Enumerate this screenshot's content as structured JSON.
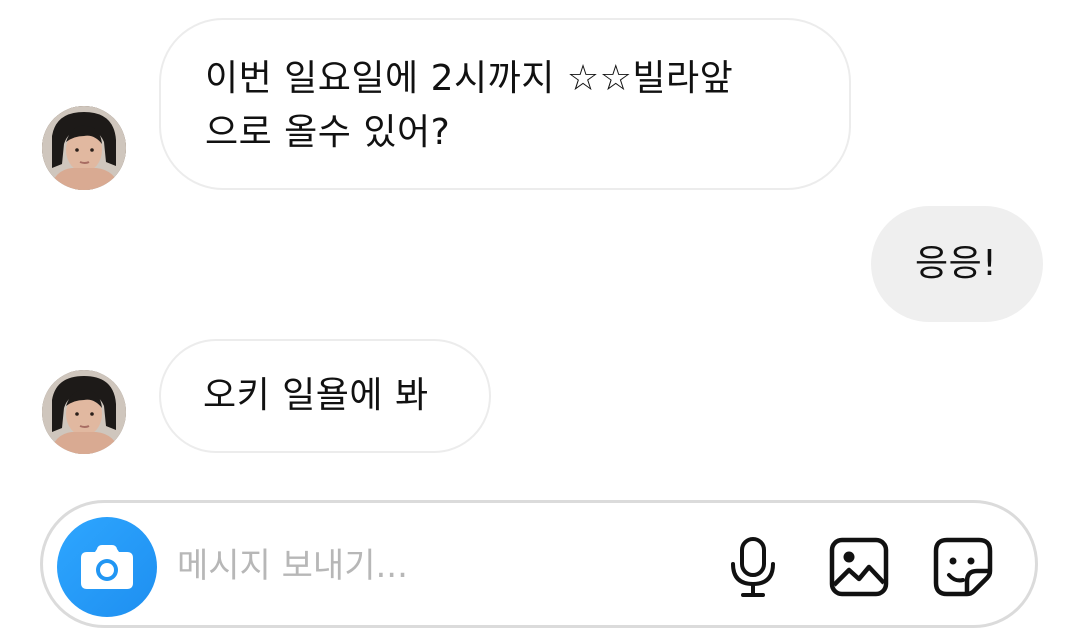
{
  "conversation": {
    "messages": [
      {
        "direction": "received",
        "lines": [
          "이번 일요일에 2시까지 ☆☆빌라앞",
          "으로 올수 있어?"
        ]
      },
      {
        "direction": "sent",
        "text": "응응!"
      },
      {
        "direction": "received",
        "text": "오키 일욜에 봐"
      }
    ]
  },
  "composer": {
    "placeholder": "메시지 보내기...",
    "camera_icon": "camera-icon",
    "mic_icon": "microphone-icon",
    "gallery_icon": "image-icon",
    "sticker_icon": "sticker-icon",
    "accent_color": "#2196f3"
  }
}
